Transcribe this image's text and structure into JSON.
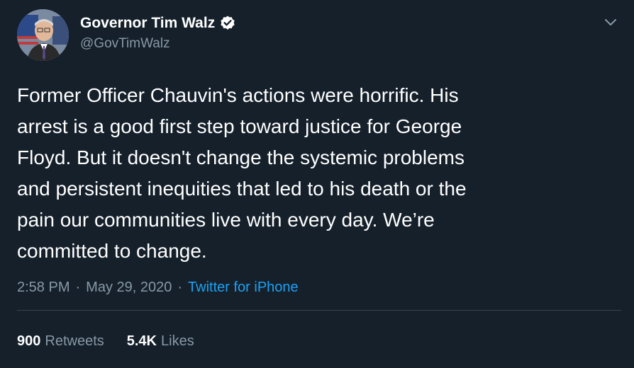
{
  "author": {
    "display_name": "Governor Tim Walz",
    "handle": "@GovTimWalz",
    "verified": true
  },
  "tweet": {
    "text": "Former Officer Chauvin's actions were horrific. His\narrest is a good first step toward justice for George\nFloyd. But it doesn't change the systemic problems\nand persistent inequities that led to his death or the\npain our communities live with every day. We’re\ncommitted to change.",
    "time": "2:58 PM",
    "separator": "·",
    "date": "May 29, 2020",
    "source": "Twitter for iPhone"
  },
  "stats": {
    "retweets_count": "900",
    "retweets_label": "Retweets",
    "likes_count": "5.4K",
    "likes_label": "Likes"
  },
  "colors": {
    "background": "#15202b",
    "secondary_text": "#8899a6",
    "accent": "#1da1f2",
    "divider": "#38444d"
  },
  "icons": {
    "verified": "verified-badge-icon",
    "menu": "chevron-down-icon"
  }
}
